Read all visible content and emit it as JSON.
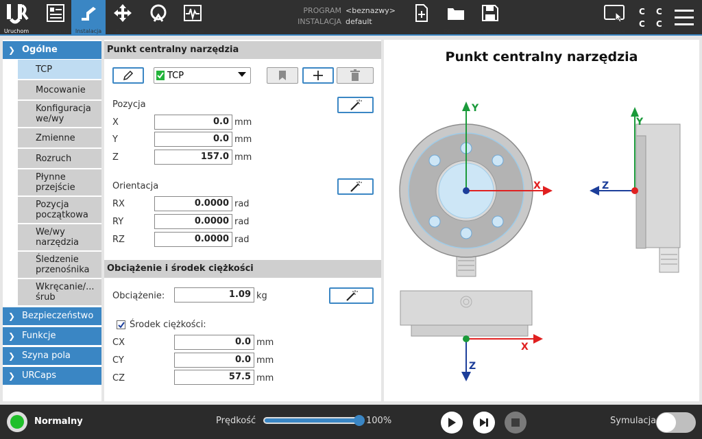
{
  "topbar": {
    "nav": [
      {
        "label": "Uruchom"
      },
      {
        "label": "Program"
      },
      {
        "label": "Instalacja"
      },
      {
        "label": "Ruch"
      },
      {
        "label": "We/wy"
      },
      {
        "label": "Dziennik"
      }
    ],
    "program_key": "PROGRAM",
    "program_value": "<beznazwy>",
    "installation_key": "INSTALACJA",
    "installation_value": "default",
    "file_buttons": [
      {
        "label": "Nowy..."
      },
      {
        "label": "Otwórz..."
      },
      {
        "label": "Zapisz..."
      }
    ],
    "local_label": "Lokalne",
    "cc_text": "C C\nC C"
  },
  "sidebar": {
    "general": "Ogólne",
    "sub_items": [
      "TCP",
      "Mocowanie",
      "Konfiguracja we/wy",
      "Zmienne",
      "Rozruch",
      "Płynne przejście",
      "Pozycja początkowa",
      "We/wy narzędzia",
      "Śledzenie przenośnika",
      "Wkręcanie/... śrub"
    ],
    "main_items": [
      "Bezpieczeństwo",
      "Funkcje",
      "Szyna pola",
      "URCaps"
    ]
  },
  "tcp_panel": {
    "title": "Punkt centralny narzędzia",
    "tcp_select": "TCP",
    "position_label": "Pozycja",
    "position": [
      {
        "axis": "X",
        "value": "0.0",
        "unit": "mm"
      },
      {
        "axis": "Y",
        "value": "0.0",
        "unit": "mm"
      },
      {
        "axis": "Z",
        "value": "157.0",
        "unit": "mm"
      }
    ],
    "orientation_label": "Orientacja",
    "orientation": [
      {
        "axis": "RX",
        "value": "0.0000",
        "unit": "rad"
      },
      {
        "axis": "RY",
        "value": "0.0000",
        "unit": "rad"
      },
      {
        "axis": "RZ",
        "value": "0.0000",
        "unit": "rad"
      }
    ]
  },
  "payload_panel": {
    "title": "Obciążenie i środek ciężkości",
    "payload_label": "Obciążenie:",
    "payload_value": "1.09",
    "payload_unit": "kg",
    "cog_label": "Środek ciężkości:",
    "cog": [
      {
        "axis": "CX",
        "value": "0.0",
        "unit": "mm"
      },
      {
        "axis": "CY",
        "value": "0.0",
        "unit": "mm"
      },
      {
        "axis": "CZ",
        "value": "57.5",
        "unit": "mm"
      }
    ]
  },
  "diagram": {
    "title": "Punkt centralny narzędzia",
    "axis_x": "X",
    "axis_y": "Y",
    "axis_z": "Z",
    "colors": {
      "x": "#e02020",
      "y": "#1a9a3a",
      "z": "#1c3e9a"
    }
  },
  "bottombar": {
    "status": "Normalny",
    "speed_label": "Prędkość",
    "speed_value": "100%",
    "speed_fraction": 1.0,
    "simulation_label": "Symulacja"
  }
}
